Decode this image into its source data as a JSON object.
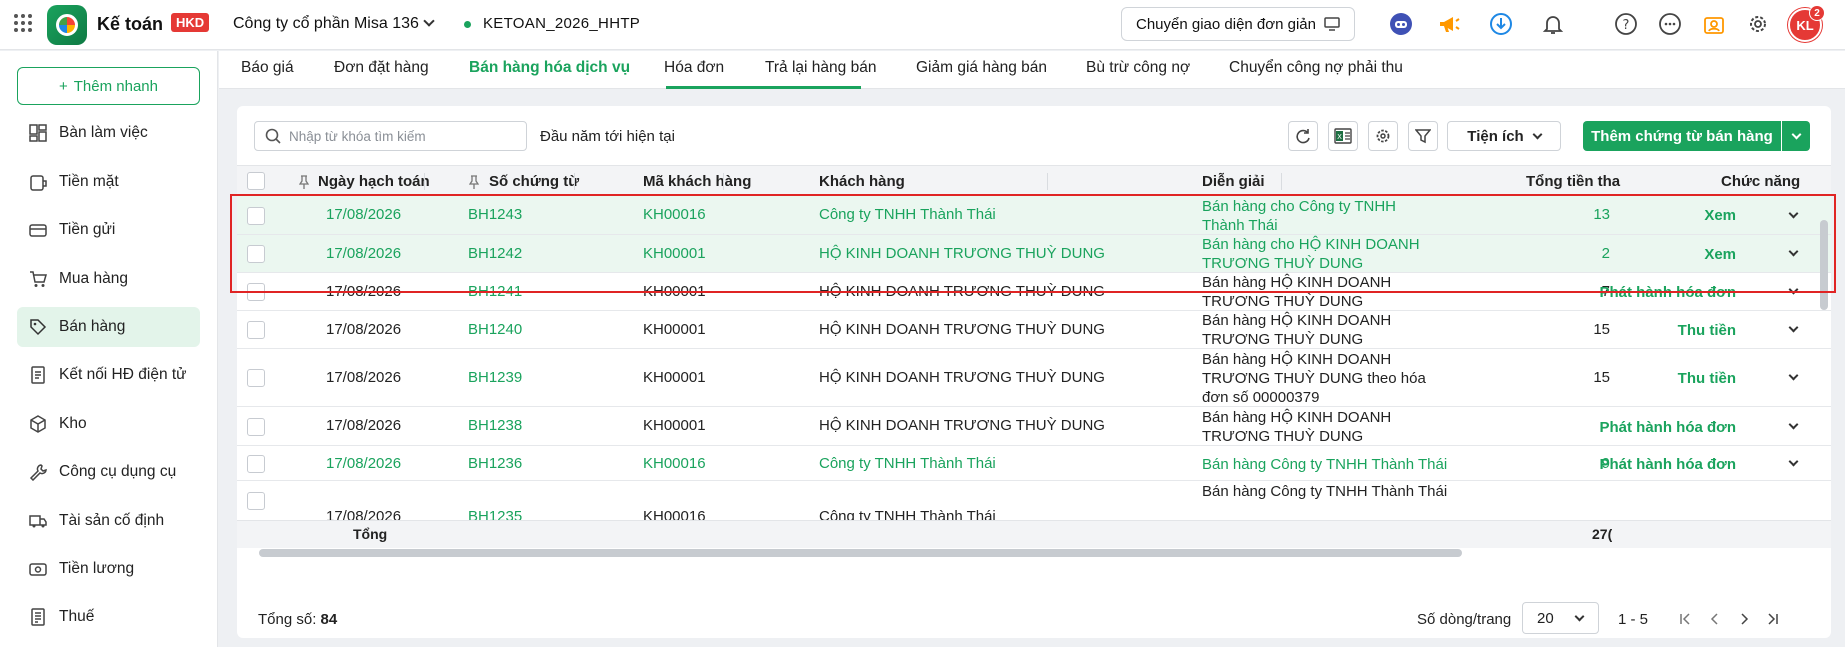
{
  "app": {
    "name": "Kế toán",
    "badge": "HKD",
    "company": "Công ty cổ phần Misa 136",
    "database": "KETOAN_2026_HHTP",
    "switch_ui": "Chuyển giao diện đơn giản",
    "avatar": "KL",
    "notification_count": "2"
  },
  "sidebar": {
    "add_quick": "Thêm nhanh",
    "items": [
      {
        "label": "Bàn làm việc",
        "icon": "dashboard-icon"
      },
      {
        "label": "Tiền mặt",
        "icon": "cash-icon"
      },
      {
        "label": "Tiền gửi",
        "icon": "bank-icon"
      },
      {
        "label": "Mua hàng",
        "icon": "cart-icon"
      },
      {
        "label": "Bán hàng",
        "icon": "tag-icon",
        "active": true
      },
      {
        "label": "Kết nối HĐ điện tử",
        "icon": "einvoice-icon"
      },
      {
        "label": "Kho",
        "icon": "box-icon"
      },
      {
        "label": "Công cụ dụng cụ",
        "icon": "wrench-icon"
      },
      {
        "label": "Tài sản cố định",
        "icon": "truck-icon"
      },
      {
        "label": "Tiền lương",
        "icon": "salary-icon"
      },
      {
        "label": "Thuế",
        "icon": "tax-icon"
      }
    ]
  },
  "tabs": [
    "Báo giá",
    "Đơn đặt hàng",
    "Bán hàng hóa dịch vụ",
    "Hóa đơn",
    "Trả lại hàng bán",
    "Giảm giá hàng bán",
    "Bù trừ công nợ",
    "Chuyển công nợ phải thu"
  ],
  "toolbar": {
    "search_placeholder": "Nhập từ khóa tìm kiếm",
    "period": "Đầu năm tới hiện tại",
    "utilities": "Tiện ích",
    "add_doc": "Thêm chứng từ bán hàng"
  },
  "table": {
    "columns": [
      "Ngày hạch toán",
      "Số chứng từ",
      "Mã khách hàng",
      "Khách hàng",
      "Diễn giải",
      "Tổng tiền tha",
      "Chức năng"
    ],
    "rows": [
      {
        "date": "17/08/2026",
        "doc": "BH1243",
        "code": "KH00016",
        "customer": "Công ty TNHH Thành Thái",
        "desc": "Bán hàng cho Công ty TNHH Thành Thái",
        "amount": "13",
        "action": "Xem",
        "highlight": true
      },
      {
        "date": "17/08/2026",
        "doc": "BH1242",
        "code": "KH00001",
        "customer": "HỘ KINH DOANH TRƯƠNG THUỲ DUNG",
        "desc": "Bán hàng cho HỘ KINH DOANH TRƯƠNG THUỲ DUNG",
        "amount": "2",
        "action": "Xem",
        "highlight": true
      },
      {
        "date": "17/08/2026",
        "doc": "BH1241",
        "code": "KH00001",
        "customer": "HỘ KINH DOANH TRƯƠNG THUỲ DUNG",
        "desc": "Bán hàng HỘ KINH DOANH TRƯƠNG THUỲ DUNG",
        "amount": "7",
        "action": "Phát hành hóa đơn"
      },
      {
        "date": "17/08/2026",
        "doc": "BH1240",
        "code": "KH00001",
        "customer": "HỘ KINH DOANH TRƯƠNG THUỲ DUNG",
        "desc": "Bán hàng HỘ KINH DOANH TRƯƠNG THUỲ DUNG",
        "amount": "15",
        "action": "Thu tiền"
      },
      {
        "date": "17/08/2026",
        "doc": "BH1239",
        "code": "KH00001",
        "customer": "HỘ KINH DOANH TRƯƠNG THUỲ DUNG",
        "desc": "Bán hàng HỘ KINH DOANH TRƯƠNG THUỲ DUNG theo hóa đơn số 00000379",
        "amount": "15",
        "action": "Thu tiền"
      },
      {
        "date": "17/08/2026",
        "doc": "BH1238",
        "code": "KH00001",
        "customer": "HỘ KINH DOANH TRƯƠNG THUỲ DUNG",
        "desc": "Bán hàng HỘ KINH DOANH TRƯƠNG THUỲ DUNG",
        "amount": "",
        "action": "Phát hành hóa đơn"
      },
      {
        "date": "17/08/2026",
        "doc": "BH1236",
        "code": "KH00016",
        "customer": "Công ty TNHH Thành Thái",
        "desc": "Bán hàng Công ty TNHH Thành Thái",
        "amount": "9",
        "action": "Phát hành hóa đơn",
        "green": true
      },
      {
        "date": "17/08/2026",
        "doc": "BH1235",
        "code": "KH00016",
        "customer": "Công ty TNHH Thành Thái",
        "desc": "Bán hàng Công ty TNHH Thành Thái",
        "amount": "",
        "action": ""
      }
    ],
    "footer_label": "Tổng",
    "footer_total": "27("
  },
  "pager": {
    "total_label": "Tổng số:",
    "total": "84",
    "page_size_label": "Số dòng/trang",
    "page_size": "20",
    "range": "1 - 5"
  },
  "colors": {
    "accent": "#1aa35d",
    "highlight_box": "#e02424"
  }
}
